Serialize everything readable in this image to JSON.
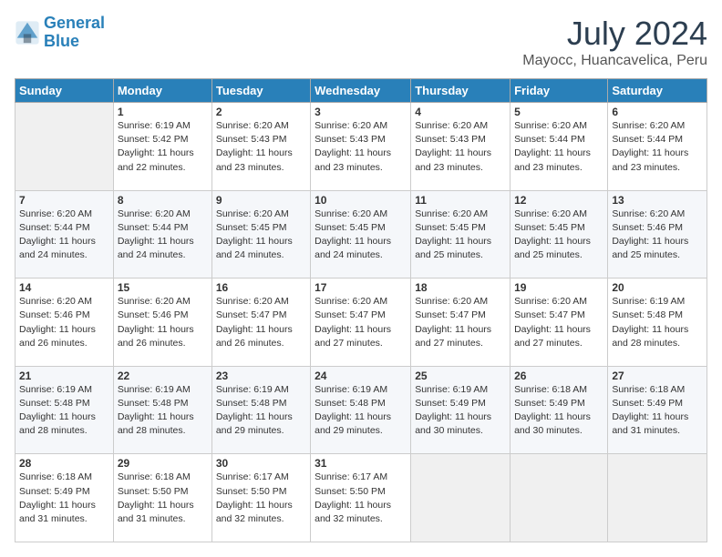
{
  "logo": {
    "line1": "General",
    "line2": "Blue"
  },
  "title": "July 2024",
  "subtitle": "Mayocc, Huancavelica, Peru",
  "header_days": [
    "Sunday",
    "Monday",
    "Tuesday",
    "Wednesday",
    "Thursday",
    "Friday",
    "Saturday"
  ],
  "weeks": [
    [
      {
        "day": "",
        "info": ""
      },
      {
        "day": "1",
        "info": "Sunrise: 6:19 AM\nSunset: 5:42 PM\nDaylight: 11 hours\nand 22 minutes."
      },
      {
        "day": "2",
        "info": "Sunrise: 6:20 AM\nSunset: 5:43 PM\nDaylight: 11 hours\nand 23 minutes."
      },
      {
        "day": "3",
        "info": "Sunrise: 6:20 AM\nSunset: 5:43 PM\nDaylight: 11 hours\nand 23 minutes."
      },
      {
        "day": "4",
        "info": "Sunrise: 6:20 AM\nSunset: 5:43 PM\nDaylight: 11 hours\nand 23 minutes."
      },
      {
        "day": "5",
        "info": "Sunrise: 6:20 AM\nSunset: 5:44 PM\nDaylight: 11 hours\nand 23 minutes."
      },
      {
        "day": "6",
        "info": "Sunrise: 6:20 AM\nSunset: 5:44 PM\nDaylight: 11 hours\nand 23 minutes."
      }
    ],
    [
      {
        "day": "7",
        "info": "Sunrise: 6:20 AM\nSunset: 5:44 PM\nDaylight: 11 hours\nand 24 minutes."
      },
      {
        "day": "8",
        "info": "Sunrise: 6:20 AM\nSunset: 5:44 PM\nDaylight: 11 hours\nand 24 minutes."
      },
      {
        "day": "9",
        "info": "Sunrise: 6:20 AM\nSunset: 5:45 PM\nDaylight: 11 hours\nand 24 minutes."
      },
      {
        "day": "10",
        "info": "Sunrise: 6:20 AM\nSunset: 5:45 PM\nDaylight: 11 hours\nand 24 minutes."
      },
      {
        "day": "11",
        "info": "Sunrise: 6:20 AM\nSunset: 5:45 PM\nDaylight: 11 hours\nand 25 minutes."
      },
      {
        "day": "12",
        "info": "Sunrise: 6:20 AM\nSunset: 5:45 PM\nDaylight: 11 hours\nand 25 minutes."
      },
      {
        "day": "13",
        "info": "Sunrise: 6:20 AM\nSunset: 5:46 PM\nDaylight: 11 hours\nand 25 minutes."
      }
    ],
    [
      {
        "day": "14",
        "info": "Sunrise: 6:20 AM\nSunset: 5:46 PM\nDaylight: 11 hours\nand 26 minutes."
      },
      {
        "day": "15",
        "info": "Sunrise: 6:20 AM\nSunset: 5:46 PM\nDaylight: 11 hours\nand 26 minutes."
      },
      {
        "day": "16",
        "info": "Sunrise: 6:20 AM\nSunset: 5:47 PM\nDaylight: 11 hours\nand 26 minutes."
      },
      {
        "day": "17",
        "info": "Sunrise: 6:20 AM\nSunset: 5:47 PM\nDaylight: 11 hours\nand 27 minutes."
      },
      {
        "day": "18",
        "info": "Sunrise: 6:20 AM\nSunset: 5:47 PM\nDaylight: 11 hours\nand 27 minutes."
      },
      {
        "day": "19",
        "info": "Sunrise: 6:20 AM\nSunset: 5:47 PM\nDaylight: 11 hours\nand 27 minutes."
      },
      {
        "day": "20",
        "info": "Sunrise: 6:19 AM\nSunset: 5:48 PM\nDaylight: 11 hours\nand 28 minutes."
      }
    ],
    [
      {
        "day": "21",
        "info": "Sunrise: 6:19 AM\nSunset: 5:48 PM\nDaylight: 11 hours\nand 28 minutes."
      },
      {
        "day": "22",
        "info": "Sunrise: 6:19 AM\nSunset: 5:48 PM\nDaylight: 11 hours\nand 28 minutes."
      },
      {
        "day": "23",
        "info": "Sunrise: 6:19 AM\nSunset: 5:48 PM\nDaylight: 11 hours\nand 29 minutes."
      },
      {
        "day": "24",
        "info": "Sunrise: 6:19 AM\nSunset: 5:48 PM\nDaylight: 11 hours\nand 29 minutes."
      },
      {
        "day": "25",
        "info": "Sunrise: 6:19 AM\nSunset: 5:49 PM\nDaylight: 11 hours\nand 30 minutes."
      },
      {
        "day": "26",
        "info": "Sunrise: 6:18 AM\nSunset: 5:49 PM\nDaylight: 11 hours\nand 30 minutes."
      },
      {
        "day": "27",
        "info": "Sunrise: 6:18 AM\nSunset: 5:49 PM\nDaylight: 11 hours\nand 31 minutes."
      }
    ],
    [
      {
        "day": "28",
        "info": "Sunrise: 6:18 AM\nSunset: 5:49 PM\nDaylight: 11 hours\nand 31 minutes."
      },
      {
        "day": "29",
        "info": "Sunrise: 6:18 AM\nSunset: 5:50 PM\nDaylight: 11 hours\nand 31 minutes."
      },
      {
        "day": "30",
        "info": "Sunrise: 6:17 AM\nSunset: 5:50 PM\nDaylight: 11 hours\nand 32 minutes."
      },
      {
        "day": "31",
        "info": "Sunrise: 6:17 AM\nSunset: 5:50 PM\nDaylight: 11 hours\nand 32 minutes."
      },
      {
        "day": "",
        "info": ""
      },
      {
        "day": "",
        "info": ""
      },
      {
        "day": "",
        "info": ""
      }
    ]
  ]
}
